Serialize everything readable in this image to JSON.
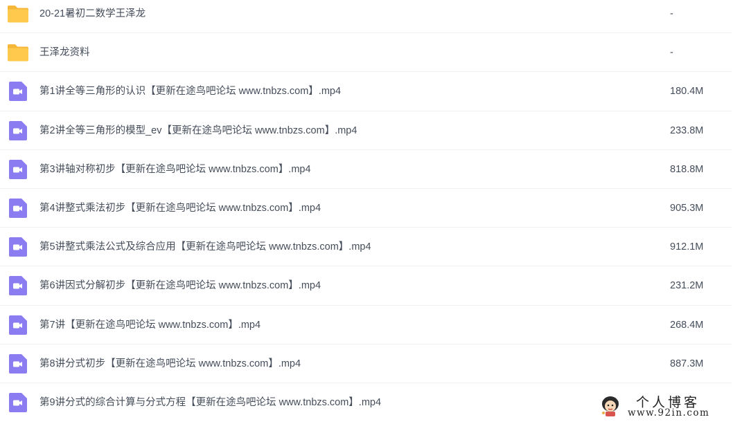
{
  "files": [
    {
      "name": "20-21暑初二数学王泽龙",
      "size": "-",
      "type": "folder",
      "icon": "folder-icon"
    },
    {
      "name": "王泽龙资料",
      "size": "-",
      "type": "folder",
      "icon": "folder-icon"
    },
    {
      "name": "第1讲全等三角形的认识【更新在途鸟吧论坛 www.tnbzs.com】.mp4",
      "size": "180.4M",
      "type": "video",
      "icon": "video-file-icon"
    },
    {
      "name": "第2讲全等三角形的模型_ev【更新在途鸟吧论坛 www.tnbzs.com】.mp4",
      "size": "233.8M",
      "type": "video",
      "icon": "video-file-icon"
    },
    {
      "name": "第3讲轴对称初步【更新在途鸟吧论坛 www.tnbzs.com】.mp4",
      "size": "818.8M",
      "type": "video",
      "icon": "video-file-icon"
    },
    {
      "name": "第4讲整式乘法初步【更新在途鸟吧论坛 www.tnbzs.com】.mp4",
      "size": "905.3M",
      "type": "video",
      "icon": "video-file-icon"
    },
    {
      "name": "第5讲整式乘法公式及综合应用【更新在途鸟吧论坛 www.tnbzs.com】.mp4",
      "size": "912.1M",
      "type": "video",
      "icon": "video-file-icon"
    },
    {
      "name": "第6讲因式分解初步【更新在途鸟吧论坛 www.tnbzs.com】.mp4",
      "size": "231.2M",
      "type": "video",
      "icon": "video-file-icon"
    },
    {
      "name": "第7讲【更新在途鸟吧论坛 www.tnbzs.com】.mp4",
      "size": "268.4M",
      "type": "video",
      "icon": "video-file-icon"
    },
    {
      "name": "第8讲分式初步【更新在途鸟吧论坛 www.tnbzs.com】.mp4",
      "size": "887.3M",
      "type": "video",
      "icon": "video-file-icon"
    },
    {
      "name": "第9讲分式的综合计算与分式方程【更新在途鸟吧论坛 www.tnbzs.com】.mp4",
      "size": "",
      "type": "video",
      "icon": "video-file-icon"
    }
  ],
  "colors": {
    "folder": "#ffc94d",
    "folder_dark": "#f5b63a",
    "video": "#8c7cf2",
    "text": "#454d5a",
    "divider": "#eef0f4"
  },
  "watermark": {
    "title": "个人博客",
    "url": "www.92in.com"
  }
}
